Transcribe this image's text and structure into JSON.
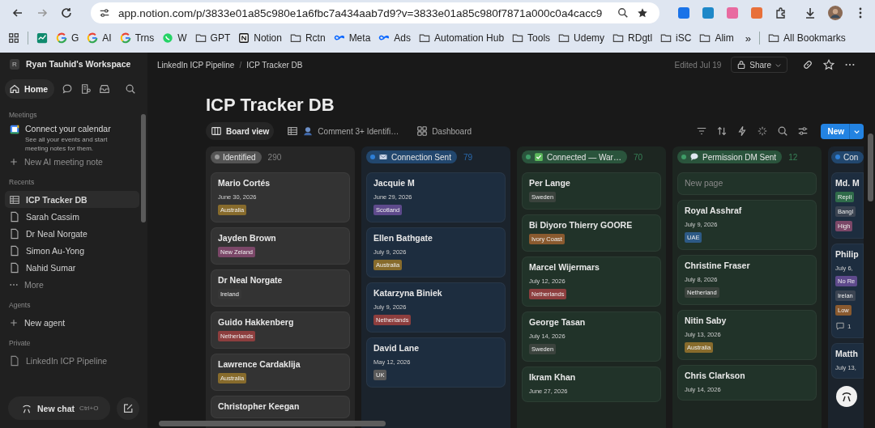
{
  "browser": {
    "url": "app.notion.com/p/3833e01a85c980e1a6fbc7a434aab7d9?v=3833e01a85c980f7871a000c0a4cacc9",
    "bookmarks": [
      {
        "kind": "chart"
      },
      {
        "kind": "google",
        "label": "G"
      },
      {
        "kind": "google",
        "label": "AI"
      },
      {
        "kind": "google",
        "label": "Trns"
      },
      {
        "kind": "whatsapp",
        "label": "W"
      },
      {
        "kind": "folder",
        "label": "GPT"
      },
      {
        "kind": "notion",
        "label": "Notion"
      },
      {
        "kind": "folder",
        "label": "Rctn"
      },
      {
        "kind": "meta",
        "label": "Meta"
      },
      {
        "kind": "meta",
        "label": "Ads"
      },
      {
        "kind": "folder",
        "label": "Automation Hub"
      },
      {
        "kind": "folder",
        "label": "Tools"
      },
      {
        "kind": "folder",
        "label": "Udemy"
      },
      {
        "kind": "folder",
        "label": "RDgtl"
      },
      {
        "kind": "folder",
        "label": "iSC"
      },
      {
        "kind": "folder",
        "label": "Alim"
      }
    ],
    "more": "»",
    "all_bookmarks": "All Bookmarks"
  },
  "sidebar": {
    "workspace_initial": "R",
    "workspace": "Ryan Tauhid's Workspace",
    "home": "Home",
    "meetings": {
      "heading": "Meetings",
      "title": "Connect your calendar",
      "description": "See all your events and start meeting notes for them.",
      "new_note": "New AI meeting note"
    },
    "recents": {
      "heading": "Recents",
      "items": [
        {
          "label": "ICP Tracker DB",
          "kind": "database",
          "selected": true
        },
        {
          "label": "Sarah Cassim",
          "kind": "page",
          "selected": false
        },
        {
          "label": "Dr Neal Norgate",
          "kind": "page",
          "selected": false
        },
        {
          "label": "Simon Au-Yong",
          "kind": "page",
          "selected": false
        },
        {
          "label": "Nahid Sumar",
          "kind": "page",
          "selected": false
        }
      ],
      "more": "More"
    },
    "agents": {
      "heading": "Agents",
      "new_agent": "New agent"
    },
    "private": {
      "heading": "Private",
      "items": [
        {
          "label": "LinkedIn ICP Pipeline"
        }
      ]
    },
    "new_chat": "New chat",
    "shortcut": "Ctrl+O"
  },
  "topbar": {
    "breadcrumbs": [
      "LinkedIn ICP Pipeline",
      "ICP Tracker DB"
    ],
    "separator": "/",
    "edited": "Edited Jul 19",
    "share": "Share"
  },
  "title": "ICP Tracker DB",
  "views": [
    {
      "label": "Board view",
      "kind": "board",
      "selected": true
    },
    {
      "label": "Comment 3+ Identifi…",
      "kind": "table",
      "selected": false
    },
    {
      "label": "Dashboard",
      "kind": "dashboard",
      "selected": false
    }
  ],
  "new_button": "New",
  "columns": [
    {
      "name": "Identified",
      "count": "290",
      "color": "#9b9b9b",
      "kind": "plain",
      "cards": [
        {
          "title": "Mario Cortés",
          "date": "June 30, 2026",
          "tags": [
            {
              "label": "Australia",
              "color": "#876b2c"
            }
          ]
        },
        {
          "title": "Jayden Brown",
          "tags": [
            {
              "label": "New Zeland",
              "color": "#7b4768"
            }
          ]
        },
        {
          "title": "Dr Neal Norgate",
          "tags": [
            {
              "label": "Ireland",
              "color": "#373737"
            }
          ]
        },
        {
          "title": "Guido Hakkenberg",
          "tags": [
            {
              "label": "Netherlands",
              "color": "#8d3e3e"
            }
          ]
        },
        {
          "title": "Lawrence Cardaklija",
          "tags": [
            {
              "label": "Australia",
              "color": "#876b2c"
            }
          ]
        },
        {
          "title": "Christopher Keegan"
        }
      ]
    },
    {
      "name": "Connection Sent",
      "count": "79",
      "color": "#2e7fd6",
      "kind": "mail",
      "cards": [
        {
          "title": "Jacquie M",
          "date": "June 29, 2026",
          "tags": [
            {
              "label": "Scotland",
              "color": "#5e4a8c"
            }
          ]
        },
        {
          "title": "Ellen Bathgate",
          "date": "July 9, 2026",
          "tags": [
            {
              "label": "Australia",
              "color": "#876b2c"
            }
          ]
        },
        {
          "title": "Katarzyna Biniek",
          "date": "July 9, 2026",
          "tags": [
            {
              "label": "Netherlands",
              "color": "#8d3e3e"
            }
          ]
        },
        {
          "title": "David Lane",
          "date": "May 12, 2026",
          "tags": [
            {
              "label": "UK",
              "color": "#5a5a5a"
            }
          ]
        }
      ]
    },
    {
      "name": "Connected — War…",
      "count": "70",
      "color": "#3f9b67",
      "kind": "check",
      "cards": [
        {
          "title": "Per Lange",
          "tags": [
            {
              "label": "Sweden",
              "color": "#3b433d"
            }
          ]
        },
        {
          "title": "Bi Diyoro Thierry GOORE",
          "tags": [
            {
              "label": "Ivory Coast",
              "color": "#8a5a2f"
            }
          ]
        },
        {
          "title": "Marcel Wijermars",
          "date": "July 12, 2026",
          "tags": [
            {
              "label": "Netherlands",
              "color": "#8d3e3e"
            }
          ]
        },
        {
          "title": "George Tasan",
          "date": "July 14, 2026",
          "tags": [
            {
              "label": "Sweden",
              "color": "#3b433d"
            }
          ]
        },
        {
          "title": "Ikram Khan",
          "date": "June 27, 2026"
        }
      ]
    },
    {
      "name": "Permission DM Sent",
      "count": "12",
      "color": "#3f9b67",
      "kind": "speech",
      "cards": [
        {
          "kind": "placeholder",
          "placeholder": "New page"
        },
        {
          "title": "Royal Asshraf",
          "date": "July 9, 2026",
          "tags": [
            {
              "label": "UAE",
              "color": "#2d5a86"
            }
          ]
        },
        {
          "title": "Christine Fraser",
          "date": "July 8, 2026",
          "tags": [
            {
              "label": "Netherland",
              "color": "#3b433d"
            }
          ]
        },
        {
          "title": "Nitin Saby",
          "date": "July 13, 2026",
          "tags": [
            {
              "label": "Australia",
              "color": "#876b2c"
            }
          ]
        },
        {
          "title": "Chris Clarkson",
          "date": "July 14, 2026"
        }
      ]
    },
    {
      "name": "Con",
      "color": "#2e7fd6",
      "kind": "plain",
      "partial": true,
      "cards": [
        {
          "title": "Md. M",
          "tags": [
            {
              "label": "Repli",
              "color": "#2f6b4a"
            },
            {
              "label": "Bangl",
              "color": "#3b4452"
            },
            {
              "label": "High",
              "color": "#7b4768"
            }
          ]
        },
        {
          "title": "Philip",
          "date": "July 6,",
          "tags": [
            {
              "label": "No Re",
              "color": "#5e4a8c"
            },
            {
              "label": "Irelan",
              "color": "#3b4452"
            },
            {
              "label": "Low",
              "color": "#8a5a2f"
            }
          ],
          "comments": "1"
        },
        {
          "title": "Matth",
          "date": "July 13,"
        }
      ]
    }
  ]
}
